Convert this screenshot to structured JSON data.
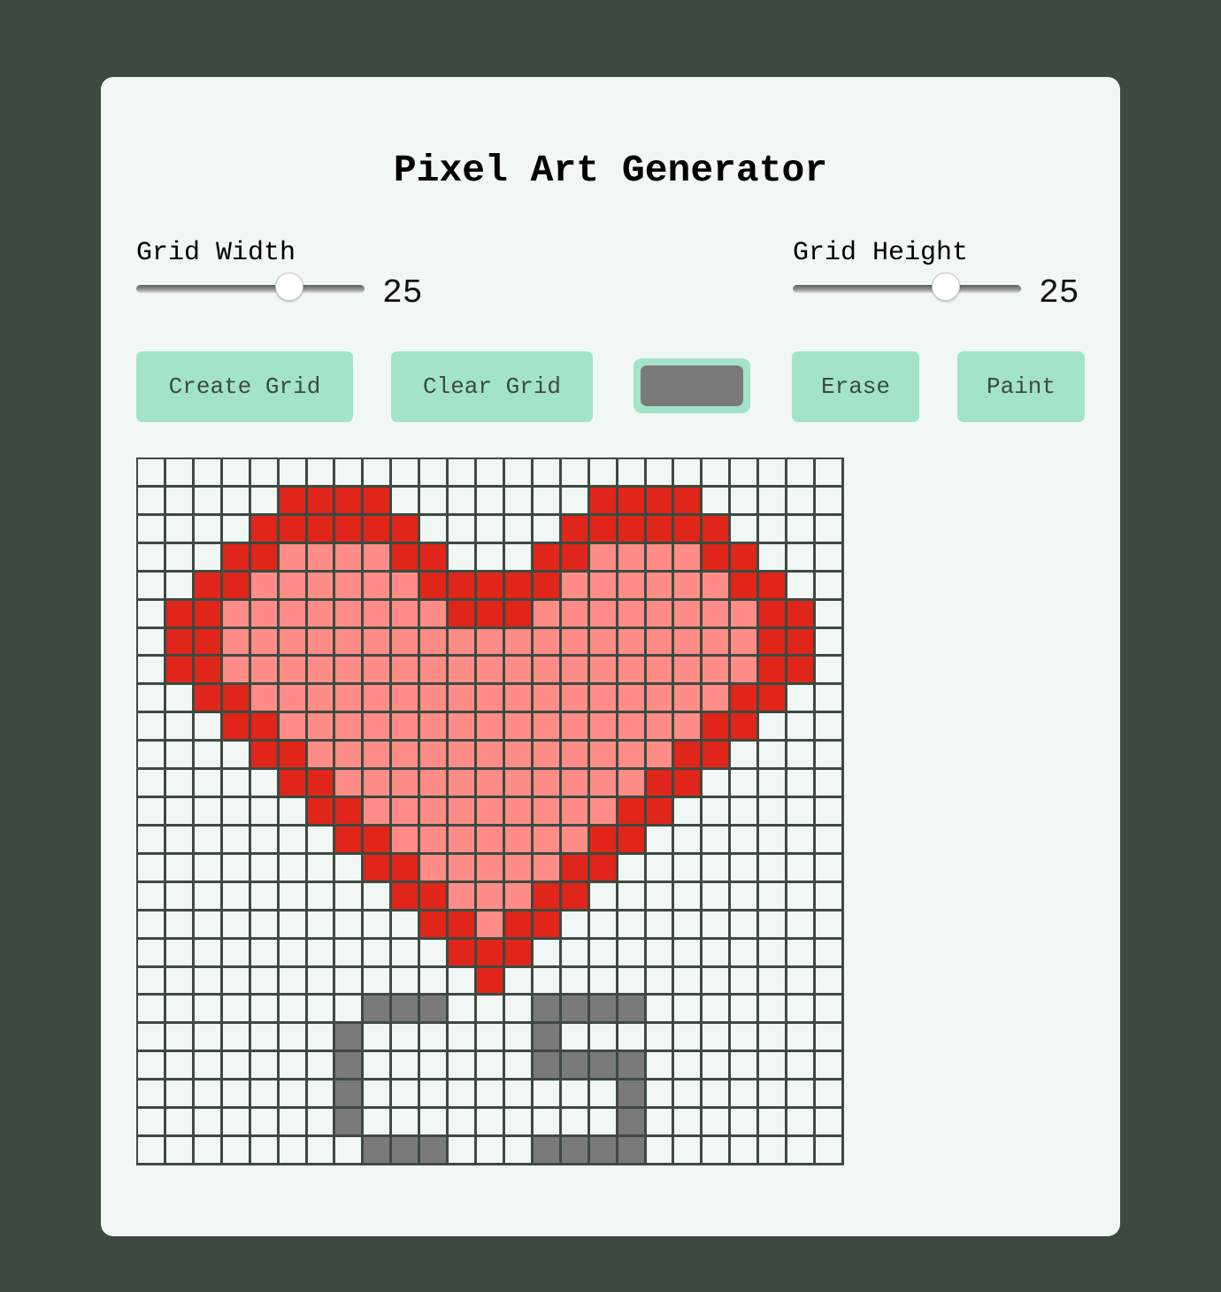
{
  "title": "Pixel Art Generator",
  "controls": {
    "width": {
      "label": "Grid Width",
      "value": "25",
      "min": 1,
      "max": 40,
      "fraction": 0.67
    },
    "height": {
      "label": "Grid Height",
      "value": "25",
      "min": 1,
      "max": 40,
      "fraction": 0.67
    }
  },
  "buttons": {
    "create": "Create Grid",
    "clear": "Clear Grid",
    "erase": "Erase",
    "paint": "Paint"
  },
  "selected_color": "#7a7a7a",
  "colors": {
    "background": "#3d4a40",
    "panel": "#f0f7f4",
    "button": "#a3e3c7",
    "cell_empty": "#f0f7f4",
    "grid_line": "#3d4a40"
  },
  "palette": {
    "R": "#e0251a",
    "P": "#ff8c87",
    "G": "#7a7a7a"
  },
  "grid_rows": [
    ".........................",
    ".....RRRR.......RRRR.....",
    "....RRRRRR.....RRRRRR....",
    "...RRPPPPRR...RRPPPPRR...",
    "..RRPPPPPPRRRRRPPPPPPRR..",
    ".RRPPPPPPPPRRRPPPPPPPPRR.",
    ".RRPPPPPPPPPPPPPPPPPPPRR.",
    ".RRPPPPPPPPPPPPPPPPPPPRR.",
    "..RRPPPPPPPPPPPPPPPPPRR..",
    "...RRPPPPPPPPPPPPPPPRR...",
    "....RRPPPPPPPPPPPPPRR....",
    ".....RRPPPPPPPPPPPRR.....",
    "......RRPPPPPPPPPRR......",
    ".......RRPPPPPPPRR.......",
    "........RRPPPPPRR........",
    ".........RRPPPRR.........",
    "..........RRPRR..........",
    "...........RRR...........",
    "............R............",
    "........GGG...GGGG.......",
    ".......G......G..........",
    ".......G......GGGG.......",
    ".......G.........G.......",
    ".......G.........G.......",
    "........GGG...GGGG......."
  ]
}
